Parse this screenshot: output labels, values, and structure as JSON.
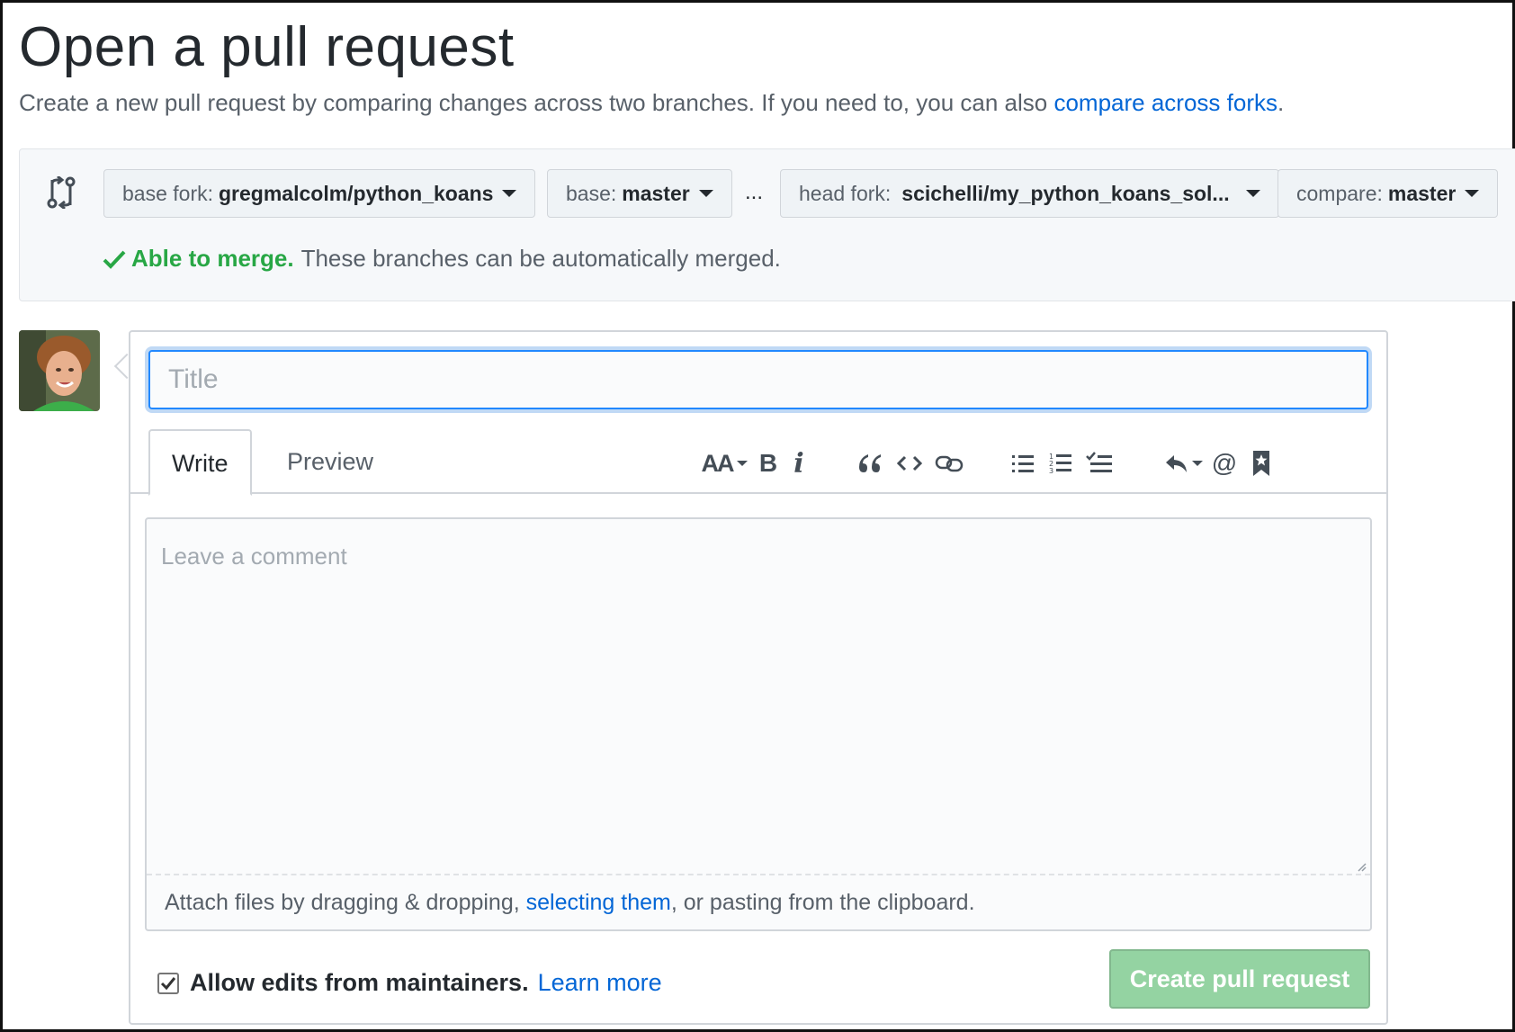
{
  "header": {
    "title": "Open a pull request",
    "subtitle": "Create a new pull request by comparing changes across two branches. If you need to, you can also",
    "subtitle_link": "compare across forks",
    "subtitle_end": "."
  },
  "range": {
    "base_fork_label": "base fork:",
    "base_fork_value": "gregmalcolm/python_koans",
    "base_label": "base:",
    "base_value": "master",
    "dots": "...",
    "head_fork_label": "head fork:",
    "head_fork_value": "scichelli/my_python_koans_sol...",
    "compare_label": "compare:",
    "compare_value": "master",
    "merge_ok": "Able to merge.",
    "merge_msg": "These branches can be automatically merged."
  },
  "form": {
    "title_placeholder": "Title",
    "tab_write": "Write",
    "tab_preview": "Preview",
    "comment_placeholder": "Leave a comment",
    "attach_prefix": "Attach files by dragging & dropping,",
    "attach_link": "selecting them",
    "attach_suffix": ", or pasting from the clipboard.",
    "allow_edits_label": "Allow edits from maintainers.",
    "allow_edits_checked": true,
    "learn_more": "Learn more",
    "create_button": "Create pull request"
  },
  "toolbar": {
    "heading_label": "AA",
    "bold_label": "B",
    "italic_label": "i",
    "mention_label": "@"
  },
  "colors": {
    "link": "#0366d6",
    "success": "#28a745",
    "create_button_disabled": "#94d3a2",
    "focus_border": "#2188ff"
  }
}
